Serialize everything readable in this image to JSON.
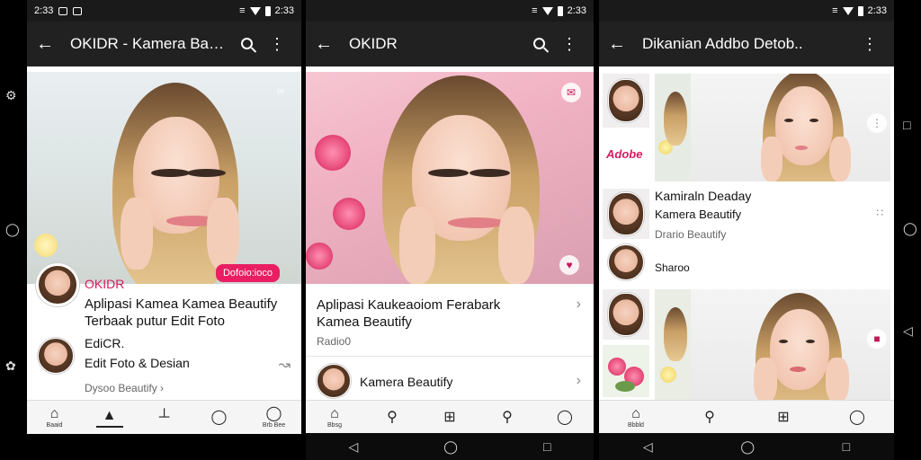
{
  "screen1": {
    "status": {
      "time": "2:33",
      "right_time": "2:33"
    },
    "appbar": {
      "title": "OKIDR - Kamera Bausia.."
    },
    "badge": "Dofoio:ioco",
    "avatar_brand": "OKIDR",
    "headline1": "Aplipasi Kamea Kamea Beautify",
    "headline2": "Terbaak putur Edit Foto",
    "item_title": "EdiCR.",
    "item_sub": "Edit Foto & Desian",
    "footer_link": "Dysoo Beautify ›",
    "nav": [
      {
        "icon": "home-icon",
        "label": "Baaid"
      },
      {
        "icon": "edit-icon",
        "label": ""
      },
      {
        "icon": "tool-icon",
        "label": ""
      },
      {
        "icon": "profile-icon",
        "label": ""
      },
      {
        "icon": "account-icon",
        "label": "Brb Bee"
      }
    ]
  },
  "screen2": {
    "status": {
      "time": "2:33"
    },
    "appbar": {
      "title": "OKIDR"
    },
    "headline1": "Aplipasi Kaukeaoiom Ferabark",
    "headline2": "Kamea Beautify",
    "meta": "Radio0",
    "item_title": "Kamera Beautify",
    "nav_label": "Bbsg"
  },
  "screen3": {
    "status": {
      "time": "2:33"
    },
    "appbar": {
      "title": "Dikanian Addbo Detob.."
    },
    "row_title": "Kamiraln Deaday",
    "row_sub": "Kamera Beautify",
    "row_meta": "Drario Beautify",
    "share": "Sharoo",
    "thumb_brand": "Adobe",
    "nav_label": "Bbbld"
  },
  "colors": {
    "accent": "#e91e63",
    "appbar": "#212121"
  }
}
